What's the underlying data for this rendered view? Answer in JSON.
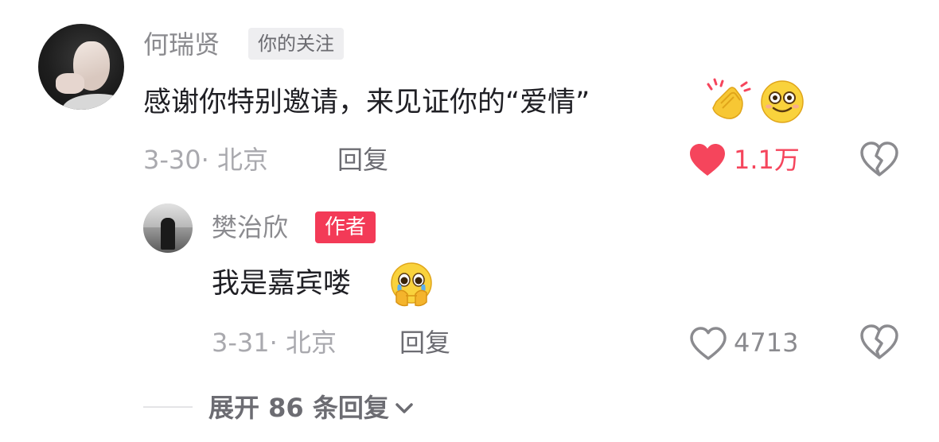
{
  "comment": {
    "username": "何瑞贤",
    "follow_tag": "你的关注",
    "text": "感谢你特别邀请，来见证你的“爱情”",
    "emojis": [
      "clapping-hands-emoji",
      "smiling-face-emoji"
    ],
    "date_location": "3-30· 北京",
    "reply_label": "回复",
    "like_count": "1.1万",
    "liked": true
  },
  "reply": {
    "username": "樊治欣",
    "author_tag": "作者",
    "text": "我是嘉宾喽",
    "emojis": [
      "pleading-face-emoji"
    ],
    "date_location": "3-31· 北京",
    "reply_label": "回复",
    "like_count": "4713",
    "liked": false
  },
  "expand": {
    "label": "展开 86 条回复"
  },
  "colors": {
    "like_active": "#f5455c",
    "author_tag_bg": "#f33a57",
    "follow_tag_bg": "#eeeef0",
    "secondary_text": "#a9a9ae",
    "primary_text": "#1f1f24"
  }
}
